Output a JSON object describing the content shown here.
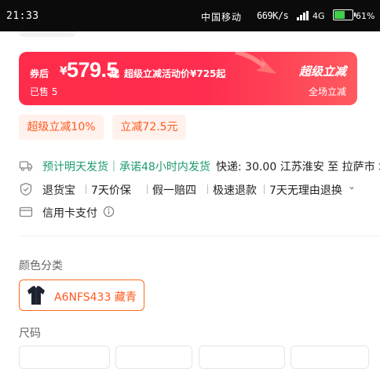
{
  "status_bar": {
    "time": "21:33",
    "carrier": "中国移动",
    "speed": "669K/s",
    "network": "4G",
    "battery_percent": "61%",
    "battery_level": 0.61
  },
  "promo": {
    "after_label": "券后",
    "currency": "¥",
    "price": "579.5",
    "price_suffix": "起",
    "activity_text": "超级立减活动价¥725起",
    "sold_text": "已售 5",
    "badge_title": "超级立减",
    "badge_sub": "全场立减"
  },
  "tags": [
    "超级立减10%",
    "立减72.5元"
  ],
  "shipping": {
    "highlight": "预计明天发货｜承诺48小时内发货",
    "detail": "快递: 30.00  江苏淮安 至 拉萨市 城关"
  },
  "guarantees": [
    "退货宝",
    "7天价保",
    "假一赔四",
    "极速退款",
    "7天无理由退换"
  ],
  "payment": {
    "label": "信用卡支付"
  },
  "colors": {
    "label": "颜色分类",
    "selected": "A6NFS433 藏青"
  },
  "size": {
    "label": "尺码"
  },
  "theme": {
    "accent": "#ff5a1f",
    "promo_red": "#ff2b4a",
    "green": "#1d9b6c"
  }
}
